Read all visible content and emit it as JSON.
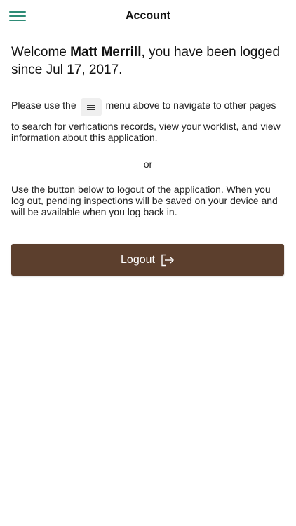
{
  "header": {
    "title": "Account",
    "menu_icon": "hamburger-menu-icon"
  },
  "welcome": {
    "prefix": "Welcome ",
    "user_name": "Matt Merrill",
    "suffix": ", you have been logged since Jul 17, 2017."
  },
  "instructions": {
    "before_icon": "Please use the",
    "after_icon": "menu above to navigate to other pages",
    "rest": "to search for verfications records, view your worklist, and view information about this application.",
    "inline_icon": "menu-icon"
  },
  "separator": "or",
  "logout_info": "Use the button below to logout of the application. When you log out, pending inspections will be saved on your device and will be available when you log back in.",
  "logout_button": {
    "label": "Logout",
    "icon": "logout-icon",
    "color": "#5c3f2d"
  },
  "colors": {
    "accent": "#2e8b76",
    "button": "#5c3f2d"
  }
}
